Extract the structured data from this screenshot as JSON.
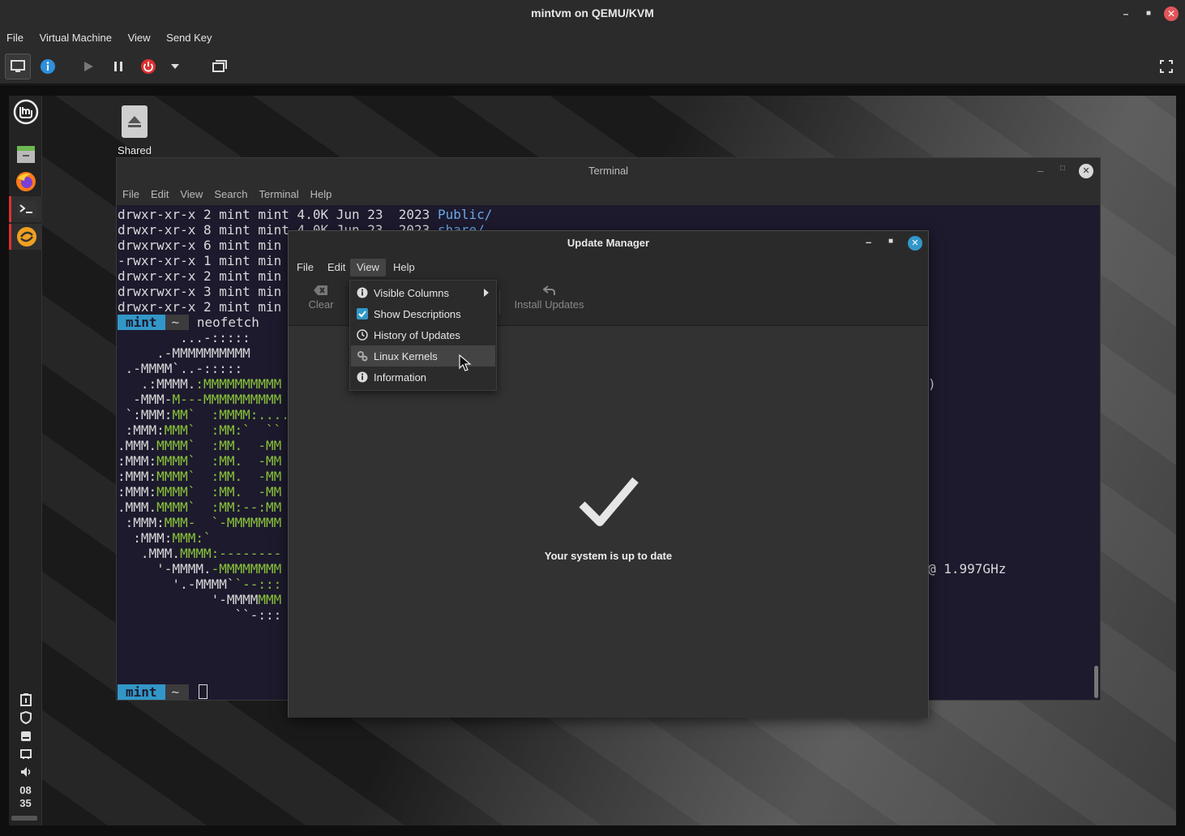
{
  "window": {
    "title": "mintvm on QEMU/KVM"
  },
  "menubar": {
    "items": [
      "File",
      "Virtual Machine",
      "View",
      "Send Key"
    ]
  },
  "desktop": {
    "shared_label": "Shared",
    "clock": {
      "hour": "08",
      "minute": "35"
    }
  },
  "terminal": {
    "title": "Terminal",
    "menu": [
      "File",
      "Edit",
      "View",
      "Search",
      "Terminal",
      "Help"
    ],
    "ls_lines": [
      {
        "text": "drwxr-xr-x 2 mint mint 4.0K Jun 23  2023 ",
        "name": "Public/"
      },
      {
        "text": "drwxr-xr-x 8 mint mint 4.0K Jun 23  2023 ",
        "name": "share/"
      },
      {
        "text": "drwxrwxr-x 6 mint min",
        "name": ""
      },
      {
        "text": "-rwxr-xr-x 1 mint min",
        "name": ""
      },
      {
        "text": "drwxr-xr-x 2 mint min",
        "name": ""
      },
      {
        "text": "drwxrwxr-x 3 mint min",
        "name": ""
      },
      {
        "text": "drwxr-xr-x 2 mint min",
        "name": ""
      }
    ],
    "prompt_user": "mint",
    "prompt_dir": "~",
    "command": "neofetch",
    "art_lines": [
      "        ...-:::::",
      "     .-MMMMMMMMMM",
      " .-MMMM`..-:::::",
      "   .:MMMM.:MMMMMMMMMM",
      "  -MMM-M---MMMMMMMMMM",
      " `:MMM:MM`  :MMMM:....",
      " :MMM:MMM`  :MM:`  ``",
      ".MMM.MMMM`  :MM.  -MM",
      ":MMM:MMMM`  :MM.  -MM",
      ":MMM:MMMM`  :MM.  -MM",
      ":MMM:MMMM`  :MM.  -MM",
      ".MMM.MMMM`  :MM:--:MM",
      " :MMM:MMM-  `-MMMMMMM",
      "  :MMM:MMM:`",
      "   .MMM.MMMM:--------",
      "     '-MMMM.-MMMMMMMM",
      "       '.-MMMM``--:::",
      "            '-MMMMMMM",
      "               ``-:::"
    ],
    "right_fragments": {
      "paren": ")",
      "cpu": "@ 1.997GHz"
    }
  },
  "update_manager": {
    "title": "Update Manager",
    "menu": [
      "File",
      "Edit",
      "View",
      "Help"
    ],
    "toolbar": {
      "clear": "Clear",
      "install": "Install Updates"
    },
    "status": "Your system is up to date"
  },
  "view_menu": {
    "items": [
      {
        "label": "Visible Columns",
        "icon": "info-icon",
        "submenu": true
      },
      {
        "label": "Show Descriptions",
        "icon": "checkbox-checked-icon",
        "checked": true
      },
      {
        "label": "History of Updates",
        "icon": "history-icon"
      },
      {
        "label": "Linux Kernels",
        "icon": "kernel-gear-icon",
        "hovered": true
      },
      {
        "label": "Information",
        "icon": "info-icon"
      }
    ]
  },
  "colors": {
    "accent": "#3297c8",
    "mint_green": "#8ac43a",
    "power_red": "#e03030"
  }
}
